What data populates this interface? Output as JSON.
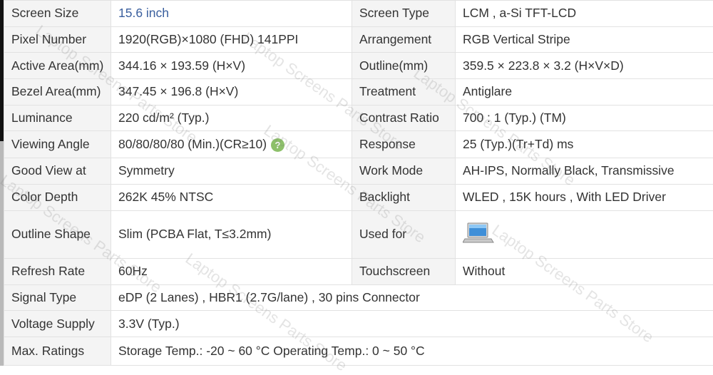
{
  "rows": [
    {
      "l1": "Screen Size",
      "v1": "15.6 inch",
      "l2": "Screen Type",
      "v2": "LCM ,   a-Si TFT-LCD"
    },
    {
      "l1": "Pixel Number",
      "v1": "1920(RGB)×1080   (FHD)  141PPI",
      "l2": "Arrangement",
      "v2": "RGB Vertical Stripe"
    },
    {
      "l1": "Active Area(mm)",
      "v1": "344.16 × 193.59 (H×V)",
      "l2": "Outline(mm)",
      "v2": "359.5 × 223.8 × 3.2 (H×V×D)"
    },
    {
      "l1": "Bezel Area(mm)",
      "v1": "347.45 × 196.8 (H×V)",
      "l2": "Treatment",
      "v2": "Antiglare"
    },
    {
      "l1": "Luminance",
      "v1": "220 cd/m² (Typ.)",
      "l2": "Contrast Ratio",
      "v2": "700 : 1 (Typ.) (TM)"
    },
    {
      "l1": "Viewing Angle",
      "v1": "80/80/80/80 (Min.)(CR≥10)",
      "l2": "Response",
      "v2": "25 (Typ.)(Tr+Td) ms"
    },
    {
      "l1": "Good View at",
      "v1": "Symmetry",
      "l2": "Work Mode",
      "v2": "AH-IPS, Normally Black, Transmissive"
    },
    {
      "l1": "Color Depth",
      "v1": "262K   45% NTSC",
      "l2": "Backlight",
      "v2": "WLED , 15K hours , With LED Driver"
    },
    {
      "l1": "Outline Shape",
      "v1": "Slim (PCBA Flat, T≤3.2mm)",
      "l2": "Used for",
      "v2": ""
    },
    {
      "l1": "Refresh Rate",
      "v1": "60Hz",
      "l2": "Touchscreen",
      "v2": "Without"
    }
  ],
  "wide_rows": [
    {
      "l": "Signal Type",
      "v": "eDP (2 Lanes) , HBR1 (2.7G/lane) , 30 pins Connector"
    },
    {
      "l": "Voltage Supply",
      "v": "3.3V (Typ.)"
    },
    {
      "l": "Max. Ratings",
      "v": "Storage Temp.: -20 ~ 60 °C    Operating Temp.: 0 ~ 50 °C"
    }
  ],
  "help_icon_glyph": "?",
  "watermark": "Laptop Screens Parts Store"
}
